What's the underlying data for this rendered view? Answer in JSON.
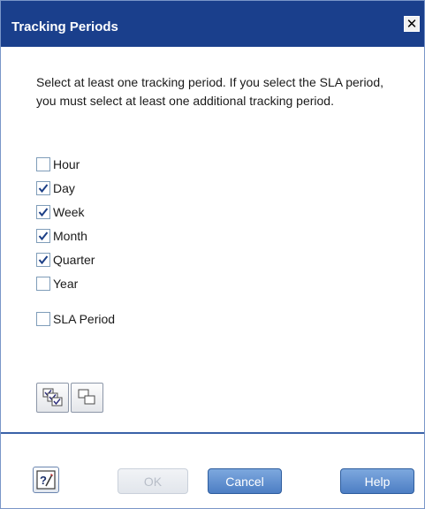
{
  "dialog": {
    "title": "Tracking Periods",
    "close_icon": "close-icon",
    "instructions": "Select at least one tracking period. If you select the SLA period, you must select at least one additional tracking period."
  },
  "periods": [
    {
      "label": "Hour",
      "checked": false
    },
    {
      "label": "Day",
      "checked": true
    },
    {
      "label": "Week",
      "checked": true
    },
    {
      "label": "Month",
      "checked": true
    },
    {
      "label": "Quarter",
      "checked": true
    },
    {
      "label": "Year",
      "checked": false
    }
  ],
  "sla": {
    "label": "SLA Period",
    "checked": false
  },
  "toolbar": {
    "select_all_icon": "select-all-icon",
    "clear_all_icon": "clear-all-icon"
  },
  "footer": {
    "help_icon": "context-help-icon",
    "ok_label": "OK",
    "ok_enabled": false,
    "cancel_label": "Cancel",
    "help_label": "Help"
  },
  "colors": {
    "titlebar": "#1a3f8c",
    "accent": "#4d7ec4",
    "check": "#1c3f86"
  }
}
